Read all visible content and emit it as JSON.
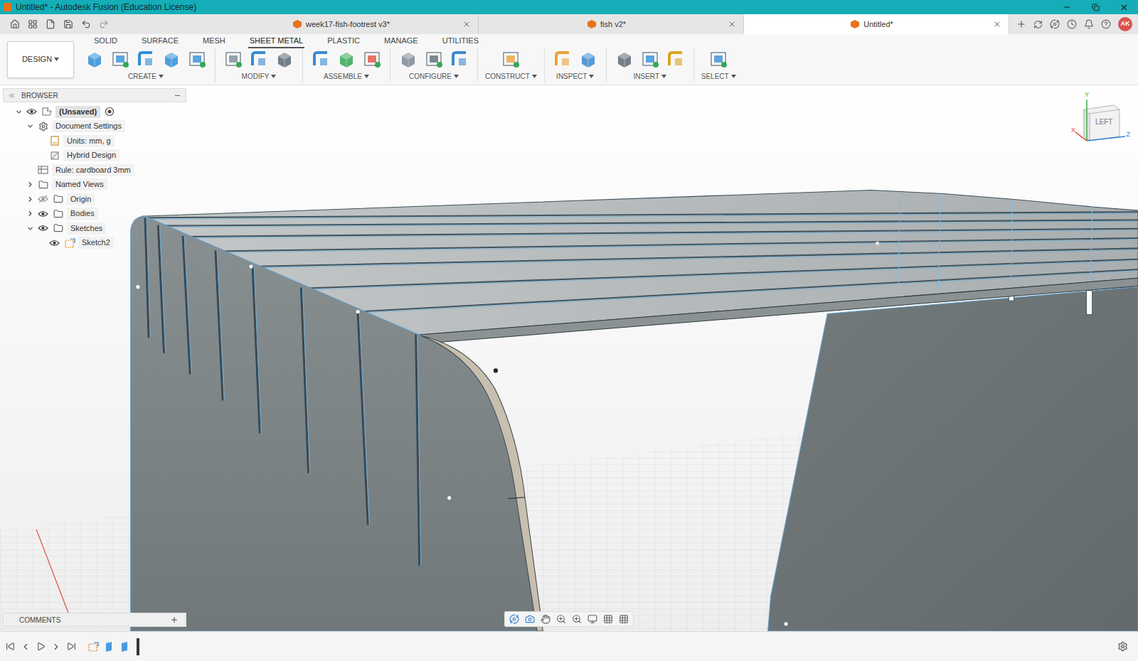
{
  "window": {
    "title": "Untitled* - Autodesk Fusion (Education License)"
  },
  "documentTabs": [
    {
      "label": "week17-fish-footrest v3*",
      "selected": false
    },
    {
      "label": "fish v2*",
      "selected": false
    },
    {
      "label": "Untitled*",
      "selected": true
    }
  ],
  "user": {
    "initials": "AK"
  },
  "workspace": {
    "label": "DESIGN"
  },
  "ribbonTabs": [
    {
      "label": "SOLID",
      "selected": false
    },
    {
      "label": "SURFACE",
      "selected": false
    },
    {
      "label": "MESH",
      "selected": false
    },
    {
      "label": "SHEET METAL",
      "selected": true
    },
    {
      "label": "PLASTIC",
      "selected": false
    },
    {
      "label": "MANAGE",
      "selected": false
    },
    {
      "label": "UTILITIES",
      "selected": false
    }
  ],
  "toolGroups": [
    {
      "label": "CREATE",
      "tools": 5
    },
    {
      "label": "MODIFY",
      "tools": 3
    },
    {
      "label": "ASSEMBLE",
      "tools": 3
    },
    {
      "label": "CONFIGURE",
      "tools": 3
    },
    {
      "label": "CONSTRUCT",
      "tools": 1
    },
    {
      "label": "INSPECT",
      "tools": 2
    },
    {
      "label": "INSERT",
      "tools": 3
    },
    {
      "label": "SELECT",
      "tools": 1
    }
  ],
  "browser": {
    "title": "BROWSER",
    "items": [
      {
        "label": "(Unsaved)",
        "kind": "root",
        "depth": 0,
        "expandable": true,
        "expanded": true,
        "hasEye": true,
        "visible": true
      },
      {
        "label": "Document Settings",
        "kind": "settings",
        "depth": 1,
        "expandable": true,
        "expanded": true,
        "hasEye": false,
        "visible": false
      },
      {
        "label": "Units: mm, g",
        "kind": "units",
        "depth": 2,
        "expandable": false,
        "expanded": false,
        "hasEye": false,
        "visible": false
      },
      {
        "label": "Hybrid Design",
        "kind": "design",
        "depth": 2,
        "expandable": false,
        "expanded": false,
        "hasEye": false,
        "visible": false
      },
      {
        "label": "Rule: cardboard 3mm",
        "kind": "rule",
        "depth": 1,
        "expandable": false,
        "expanded": false,
        "hasEye": false,
        "visible": false
      },
      {
        "label": "Named Views",
        "kind": "folder",
        "depth": 1,
        "expandable": true,
        "expanded": false,
        "hasEye": false,
        "visible": false
      },
      {
        "label": "Origin",
        "kind": "folder",
        "depth": 1,
        "expandable": true,
        "expanded": false,
        "hasEye": true,
        "visible": false
      },
      {
        "label": "Bodies",
        "kind": "folder",
        "depth": 1,
        "expandable": true,
        "expanded": false,
        "hasEye": true,
        "visible": true
      },
      {
        "label": "Sketches",
        "kind": "folder",
        "depth": 1,
        "expandable": true,
        "expanded": true,
        "hasEye": true,
        "visible": true
      },
      {
        "label": "Sketch2",
        "kind": "sketch",
        "depth": 2,
        "expandable": false,
        "expanded": false,
        "hasEye": true,
        "visible": true
      }
    ]
  },
  "viewCube": {
    "face": "LEFT",
    "axes": [
      {
        "label": "Y",
        "color": "#3cb043"
      },
      {
        "label": "X",
        "color": "#e04040"
      },
      {
        "label": "Z",
        "color": "#2f7fd8"
      }
    ]
  },
  "comments": {
    "label": "COMMENTS"
  }
}
